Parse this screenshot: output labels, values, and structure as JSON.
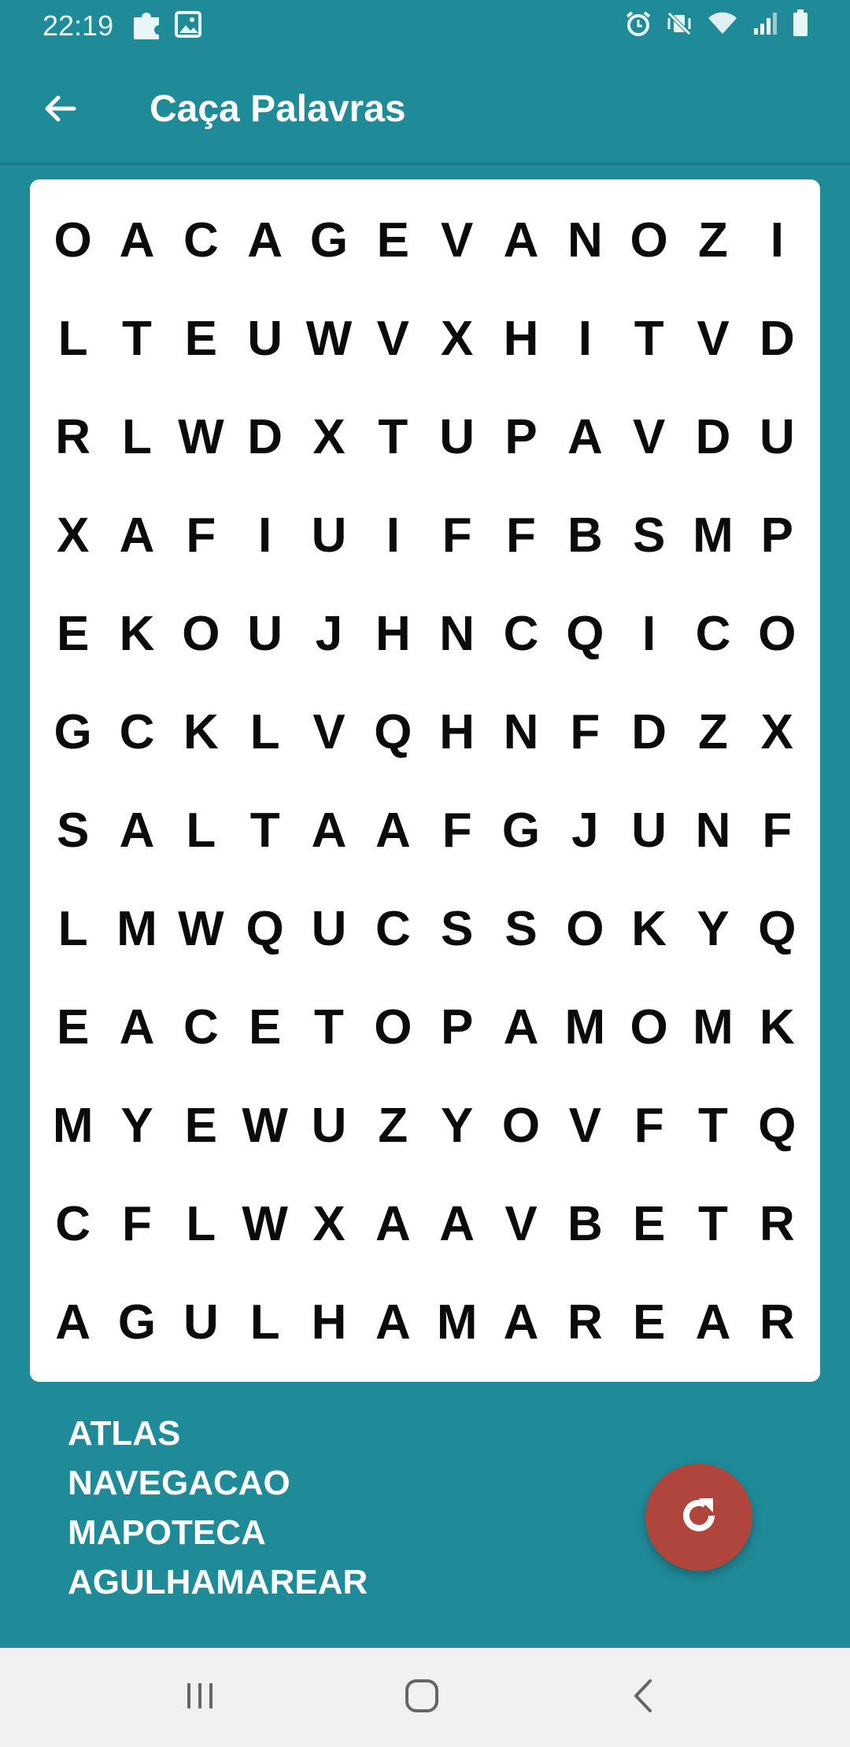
{
  "status_bar": {
    "time": "22:19",
    "left_icons": [
      "puzzle-icon",
      "image-icon"
    ],
    "right_icons": [
      "alarm-icon",
      "vibrate-mute-icon",
      "wifi-icon",
      "signal-icon",
      "battery-icon"
    ]
  },
  "app_bar": {
    "title": "Caça Palavras",
    "back_icon": "arrow-left-icon"
  },
  "grid": {
    "rows": [
      [
        "O",
        "A",
        "C",
        "A",
        "G",
        "E",
        "V",
        "A",
        "N",
        "O",
        "Z",
        "I"
      ],
      [
        "L",
        "T",
        "E",
        "U",
        "W",
        "V",
        "X",
        "H",
        "I",
        "T",
        "V",
        "D"
      ],
      [
        "R",
        "L",
        "W",
        "D",
        "X",
        "T",
        "U",
        "P",
        "A",
        "V",
        "D",
        "U"
      ],
      [
        "X",
        "A",
        "F",
        "I",
        "U",
        "I",
        "F",
        "F",
        "B",
        "S",
        "M",
        "P"
      ],
      [
        "E",
        "K",
        "O",
        "U",
        "J",
        "H",
        "N",
        "C",
        "Q",
        "I",
        "C",
        "O"
      ],
      [
        "G",
        "C",
        "K",
        "L",
        "V",
        "Q",
        "H",
        "N",
        "F",
        "D",
        "Z",
        "X"
      ],
      [
        "S",
        "A",
        "L",
        "T",
        "A",
        "A",
        "F",
        "G",
        "J",
        "U",
        "N",
        "F"
      ],
      [
        "L",
        "M",
        "W",
        "Q",
        "U",
        "C",
        "S",
        "S",
        "O",
        "K",
        "Y",
        "Q"
      ],
      [
        "E",
        "A",
        "C",
        "E",
        "T",
        "O",
        "P",
        "A",
        "M",
        "O",
        "M",
        "K"
      ],
      [
        "M",
        "Y",
        "E",
        "W",
        "U",
        "Z",
        "Y",
        "O",
        "V",
        "F",
        "T",
        "Q"
      ],
      [
        "C",
        "F",
        "L",
        "W",
        "X",
        "A",
        "A",
        "V",
        "B",
        "E",
        "T",
        "R"
      ],
      [
        "A",
        "G",
        "U",
        "L",
        "H",
        "A",
        "M",
        "A",
        "R",
        "E",
        "A",
        "R"
      ]
    ]
  },
  "words": [
    "ATLAS",
    "NAVEGACAO",
    "MAPOTECA",
    "AGULHAMAREAR"
  ],
  "fab": {
    "icon": "refresh-icon",
    "color": "#b0453b"
  },
  "nav_bar": {
    "buttons": [
      "recent-apps-icon",
      "home-icon",
      "back-icon"
    ]
  },
  "colors": {
    "primary": "#1f8a98",
    "card": "#ffffff",
    "letters": "#0b0b0b"
  }
}
